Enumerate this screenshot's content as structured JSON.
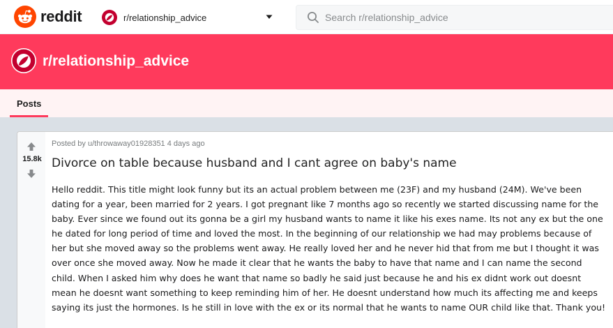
{
  "header": {
    "logo_text": "reddit",
    "community": "r/relationship_advice",
    "search_placeholder": "Search r/relationship_advice"
  },
  "banner": {
    "title": "r/relationship_advice"
  },
  "tabs": [
    {
      "label": "Posts",
      "active": true
    }
  ],
  "post": {
    "score": "15.8k",
    "meta_prefix": "Posted by ",
    "author": "u/throwaway01928351",
    "age": "4 days ago",
    "title": "Divorce on table because husband and I cant agree on baby's name",
    "body": "Hello reddit. This title might look funny but its an actual problem between me (23F) and my husband (24M). We've been dating for a year, been married for 2 years. I got pregnant like 7 months ago so recently we started discussing name for the baby. Ever since we found out its gonna be a girl my husband wants to name it like his exes name. Its not any ex but the one he dated for long period of time and loved the most. In the beginning of our relationship we had may problems because of her but she moved away so the problems went away. He really loved her and he never hid that from me but I thought it was over once she moved away. Now he made it clear that he wants the baby to have that name and I can name the second child. When I asked him why does he want that name so badly he said just because he and his ex didnt work out doesnt mean he doesnt want something to keep reminding him of her. He doesnt understand how much its affecting me and keeps saying its just the hormones. Is he still in love with the ex or its normal that he wants to name OUR child like that. Thank you!"
  },
  "colors": {
    "reddit_orange": "#ff4500",
    "banner": "#ff3a5c",
    "sub_icon": "#c3002f",
    "tab_bg": "#fff3f4",
    "page_bg": "#dae0e6"
  }
}
